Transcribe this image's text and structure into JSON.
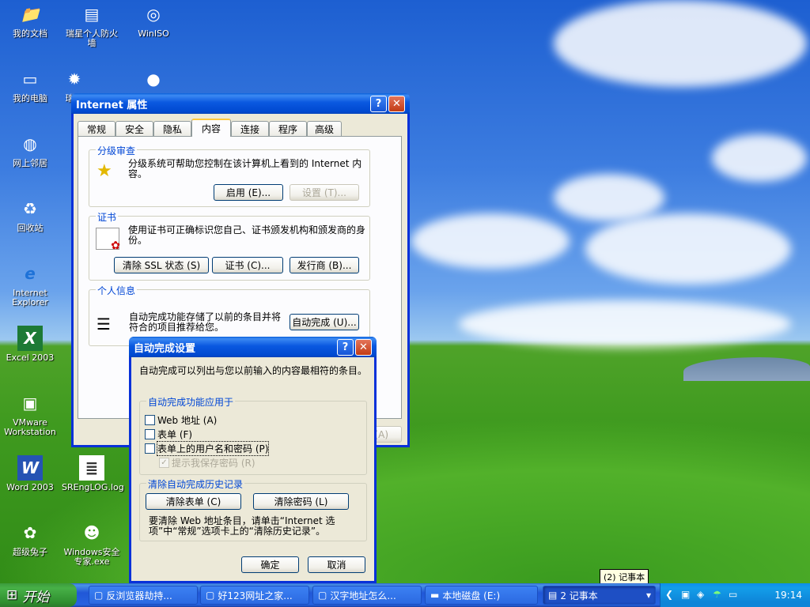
{
  "desktop": {
    "icons": [
      {
        "label": "我的文档",
        "glyph": "📁"
      },
      {
        "label": "瑞星个人防火墙",
        "glyph": "▤"
      },
      {
        "label": "WinISO",
        "glyph": "◎"
      },
      {
        "label": "我的电脑",
        "glyph": "▭"
      },
      {
        "label": "瑞",
        "glyph": "✹"
      },
      {
        "label": "",
        "glyph": "●"
      },
      {
        "label": "网上邻居",
        "glyph": "◍"
      },
      {
        "label": "回收站",
        "glyph": "♻"
      },
      {
        "label": "Internet Explorer",
        "glyph": "e"
      },
      {
        "label": "Excel 2003",
        "glyph": "X"
      },
      {
        "label": "VMware Workstation",
        "glyph": "▣"
      },
      {
        "label": "Word 2003",
        "glyph": "W"
      },
      {
        "label": "SREngLOG.log",
        "glyph": "≣"
      },
      {
        "label": "超级兔子",
        "glyph": "✿"
      },
      {
        "label": "Windows安全专家.exe",
        "glyph": "☻"
      }
    ]
  },
  "internet_props": {
    "title": "Internet 属性",
    "tabs": [
      "常规",
      "安全",
      "隐私",
      "内容",
      "连接",
      "程序",
      "高级"
    ],
    "active_tab": "内容",
    "rating": {
      "title": "分级审查",
      "text": "分级系统可帮助您控制在该计算机上看到的 Internet 内容。",
      "enable_btn": "启用 (E)...",
      "settings_btn": "设置 (T)..."
    },
    "certs": {
      "title": "证书",
      "text": "使用证书可正确标识您自己、证书颁发机构和颁发商的身份。",
      "clear_ssl_btn": "清除 SSL 状态 (S)",
      "certs_btn": "证书 (C)...",
      "publishers_btn": "发行商 (B)..."
    },
    "personal": {
      "title": "个人信息",
      "text": "自动完成功能存储了以前的条目并将符合的项目推荐给您。",
      "autocomplete_btn": "自动完成 (U)..."
    },
    "apply_btn": "(A)"
  },
  "autocomplete": {
    "title": "自动完成设置",
    "intro": "自动完成可以列出与您以前输入的内容最相符的条目。",
    "use_for": {
      "title": "自动完成功能应用于",
      "web": "Web 地址 (A)",
      "forms": "表单 (F)",
      "passwords": "表单上的用户名和密码 (P)",
      "prompt": "提示我保存密码 (R)"
    },
    "clear": {
      "title": "清除自动完成历史记录",
      "clear_forms_btn": "清除表单 (C)",
      "clear_passwords_btn": "清除密码 (L)",
      "note": "要清除 Web 地址条目，请单击“Internet 选项”中“常规”选项卡上的“清除历史记录”。"
    },
    "ok_btn": "确定",
    "cancel_btn": "取消"
  },
  "taskbar": {
    "start_label": "开始",
    "tasks": [
      "反浏览器劫持...",
      "好123网址之家...",
      "汉字地址怎么...",
      "本地磁盘 (E:)",
      "2 记事本"
    ],
    "tooltip": "(2) 记事本",
    "clock": "19:14"
  }
}
